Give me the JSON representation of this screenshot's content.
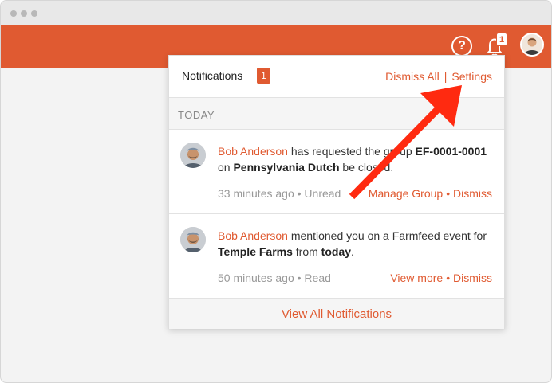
{
  "header": {
    "help_label": "?",
    "bell_count": "1"
  },
  "notifications": {
    "title": "Notifications",
    "count": "1",
    "dismiss_all": "Dismiss All",
    "separator": "|",
    "settings": "Settings",
    "section": "TODAY",
    "items": [
      {
        "name": "Bob Anderson",
        "text1": " has requested the group ",
        "bold1": "EF-0001-0001",
        "text2": " on ",
        "bold2": "Pennsylvania Dutch",
        "text3": " be closed.",
        "time": "33 minutes ago",
        "status": "• Unread",
        "action": "Manage Group",
        "dismiss": "• Dismiss"
      },
      {
        "name": "Bob Anderson",
        "text1": " mentioned you on a Farmfeed event for ",
        "bold1": "Temple Farms",
        "text2": " from ",
        "bold2": "today",
        "text3": ".",
        "time": "50 minutes ago",
        "status": "• Read",
        "action": "View more",
        "dismiss": "• Dismiss"
      }
    ],
    "footer": "View All Notifications"
  },
  "colors": {
    "brand": "#e05a31",
    "arrow": "#ff2a10"
  }
}
